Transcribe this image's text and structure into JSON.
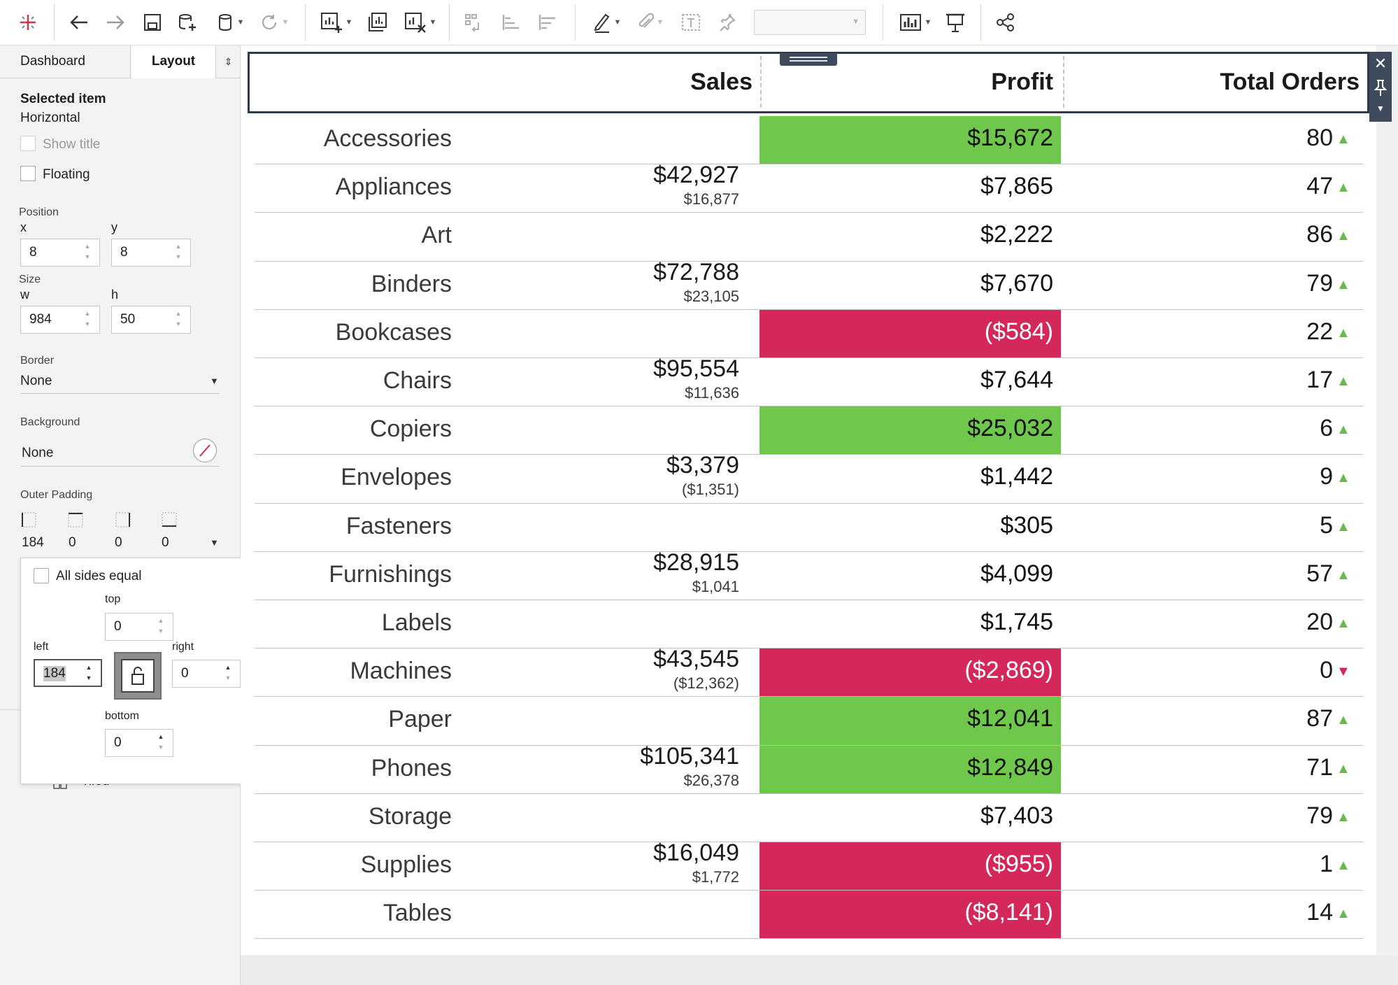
{
  "toolbar": {
    "icons": [
      "tableau-logo-icon",
      "back-icon",
      "forward-icon",
      "save-icon",
      "new-datasource-icon",
      "datasource-icon",
      "refresh-icon",
      "new-worksheet-icon",
      "duplicate-sheet-icon",
      "clear-sheet-icon",
      "swap-icon",
      "sort-ascending-icon",
      "sort-descending-icon",
      "highlight-icon",
      "annotate-icon",
      "text-label-icon",
      "pin-icon",
      "show-me-icon",
      "presentation-icon",
      "share-icon"
    ]
  },
  "left_panel": {
    "tabs": [
      "Dashboard",
      "Layout"
    ],
    "selected_item_title": "Selected item",
    "selected_item_value": "Horizontal",
    "show_title_label": "Show title",
    "floating_label": "Floating",
    "position_label": "Position",
    "x_label": "x",
    "y_label": "y",
    "x_value": "8",
    "y_value": "8",
    "size_label": "Size",
    "w_label": "w",
    "h_label": "h",
    "w_value": "984",
    "h_value": "50",
    "border_label": "Border",
    "border_value": "None",
    "background_label": "Background",
    "background_value": "None",
    "outer_padding_label": "Outer Padding",
    "outer_padding_values": [
      "184",
      "0",
      "0",
      "0"
    ],
    "tiled_label": "Tiled"
  },
  "padding_popup": {
    "all_sides_equal_label": "All sides equal",
    "top_label": "top",
    "top_value": "0",
    "left_label": "left",
    "left_value": "184",
    "right_label": "right",
    "right_value": "0",
    "bottom_label": "bottom",
    "bottom_value": "0"
  },
  "table": {
    "headers": {
      "sales": "Sales",
      "profit": "Profit",
      "orders": "Total Orders"
    },
    "colors": {
      "positive": "#6fc74c",
      "negative": "#d4285a",
      "up_triangle": "#6ab84f",
      "down_triangle": "#d4285a"
    },
    "rows": [
      {
        "category": "Accessories",
        "sales": "",
        "sales_sub": "",
        "profit": "$15,672",
        "highlight": "positive",
        "orders": "80",
        "trend": "up"
      },
      {
        "category": "Appliances",
        "sales": "$42,927",
        "sales_sub": "$16,877",
        "profit": "$7,865",
        "highlight": "none",
        "orders": "47",
        "trend": "up"
      },
      {
        "category": "Art",
        "sales": "",
        "sales_sub": "",
        "profit": "$2,222",
        "highlight": "none",
        "orders": "86",
        "trend": "up"
      },
      {
        "category": "Binders",
        "sales": "$72,788",
        "sales_sub": "$23,105",
        "profit": "$7,670",
        "highlight": "none",
        "orders": "79",
        "trend": "up"
      },
      {
        "category": "Bookcases",
        "sales": "",
        "sales_sub": "",
        "profit": "($584)",
        "highlight": "negative",
        "orders": "22",
        "trend": "up"
      },
      {
        "category": "Chairs",
        "sales": "$95,554",
        "sales_sub": "$11,636",
        "profit": "$7,644",
        "highlight": "none",
        "orders": "17",
        "trend": "up"
      },
      {
        "category": "Copiers",
        "sales": "",
        "sales_sub": "",
        "profit": "$25,032",
        "highlight": "positive",
        "orders": "6",
        "trend": "up"
      },
      {
        "category": "Envelopes",
        "sales": "$3,379",
        "sales_sub": "($1,351)",
        "profit": "$1,442",
        "highlight": "none",
        "orders": "9",
        "trend": "up"
      },
      {
        "category": "Fasteners",
        "sales": "",
        "sales_sub": "",
        "profit": "$305",
        "highlight": "none",
        "orders": "5",
        "trend": "up"
      },
      {
        "category": "Furnishings",
        "sales": "$28,915",
        "sales_sub": "$1,041",
        "profit": "$4,099",
        "highlight": "none",
        "orders": "57",
        "trend": "up"
      },
      {
        "category": "Labels",
        "sales": "",
        "sales_sub": "",
        "profit": "$1,745",
        "highlight": "none",
        "orders": "20",
        "trend": "up"
      },
      {
        "category": "Machines",
        "sales": "$43,545",
        "sales_sub": "($12,362)",
        "profit": "($2,869)",
        "highlight": "negative",
        "orders": "0",
        "trend": "down"
      },
      {
        "category": "Paper",
        "sales": "",
        "sales_sub": "",
        "profit": "$12,041",
        "highlight": "positive",
        "orders": "87",
        "trend": "up"
      },
      {
        "category": "Phones",
        "sales": "$105,341",
        "sales_sub": "$26,378",
        "profit": "$12,849",
        "highlight": "positive",
        "orders": "71",
        "trend": "up"
      },
      {
        "category": "Storage",
        "sales": "",
        "sales_sub": "",
        "profit": "$7,403",
        "highlight": "none",
        "orders": "79",
        "trend": "up"
      },
      {
        "category": "Supplies",
        "sales": "$16,049",
        "sales_sub": "$1,772",
        "profit": "($955)",
        "highlight": "negative",
        "orders": "1",
        "trend": "up"
      },
      {
        "category": "Tables",
        "sales": "",
        "sales_sub": "",
        "profit": "($8,141)",
        "highlight": "negative",
        "orders": "14",
        "trend": "up"
      }
    ]
  }
}
